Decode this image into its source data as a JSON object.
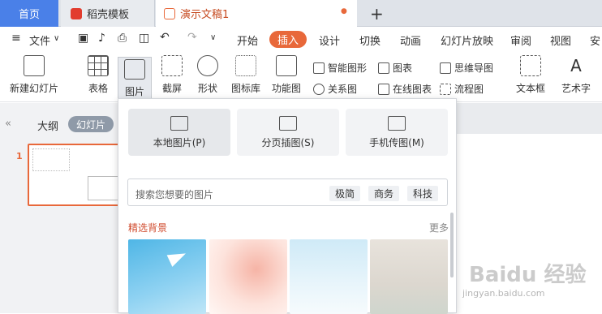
{
  "tabs": {
    "home": "首页",
    "daoke": "稻壳模板",
    "doc": "演示文稿1",
    "doc_dot": "●",
    "plus": "+"
  },
  "menubar": {
    "file": "文件",
    "items": [
      "开始",
      "插入",
      "设计",
      "切换",
      "动画",
      "幻灯片放映",
      "审阅",
      "视图",
      "安"
    ]
  },
  "ribbon": {
    "new_slide": "新建幻灯片",
    "table": "表格",
    "picture": "图片",
    "screenshot": "截屏",
    "shape": "形状",
    "icon_lib": "图标库",
    "func_chart": "功能图",
    "smart_shape": "智能图形",
    "chart": "图表",
    "relation": "关系图",
    "online_chart": "在线图表",
    "mindmap": "思维导图",
    "flowchart": "流程图",
    "textbox": "文本框",
    "art_text": "艺术字"
  },
  "left_panel": {
    "outline": "大纲",
    "slides": "幻灯片",
    "slide_number": "1"
  },
  "dropdown": {
    "local_picture": "本地图片(P)",
    "page_insert": "分页插图(S)",
    "phone_picture": "手机传图(M)",
    "search_placeholder": "搜索您想要的图片",
    "chips": [
      "极简",
      "商务",
      "科技"
    ],
    "featured_title": "精选背景",
    "more": "更多"
  },
  "watermark": {
    "text": "Baidu 经验",
    "url": "jingyan.baidu.com"
  },
  "colors": {
    "accent": "#e8683a",
    "home_tab": "#4a80e8"
  }
}
